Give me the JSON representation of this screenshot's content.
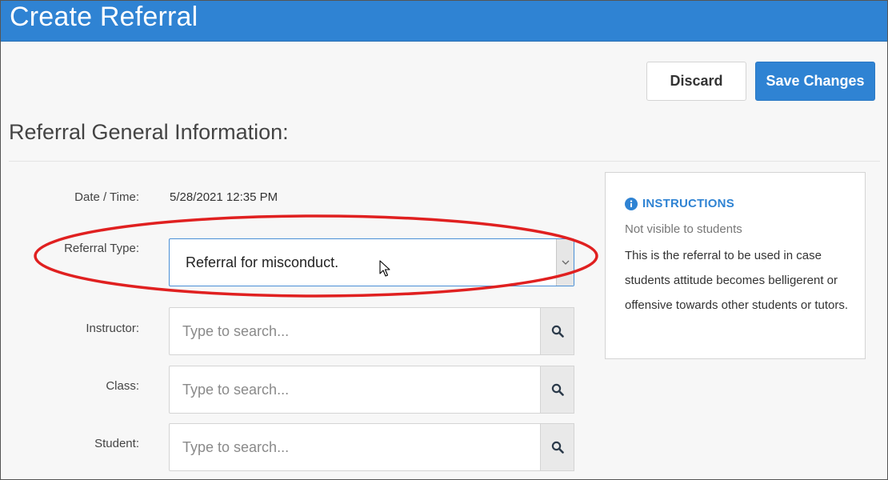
{
  "header": {
    "title": "Create Referral"
  },
  "actions": {
    "discard_label": "Discard",
    "save_label": "Save Changes"
  },
  "section": {
    "title": "Referral General Information:"
  },
  "form": {
    "date_label": "Date / Time:",
    "date_value": "5/28/2021 12:35 PM",
    "type_label": "Referral Type:",
    "type_value": "Referral for misconduct.",
    "instructor_label": "Instructor:",
    "instructor_placeholder": "Type to search...",
    "class_label": "Class:",
    "class_placeholder": "Type to search...",
    "student_label": "Student:",
    "student_placeholder": "Type to search..."
  },
  "instructions": {
    "heading": "INSTRUCTIONS",
    "note": "Not visible to students",
    "body": "This is the referral to be used in case students attitude becomes belligerent or offensive towards other students or tutors."
  },
  "icons": {
    "info": "info-icon",
    "search": "search-icon",
    "dropdown": "chevron-down-icon",
    "cursor": "mouse-cursor-icon"
  },
  "colors": {
    "header_bg": "#2f83d3",
    "primary_button": "#2f83d3",
    "annotation": "#e02020"
  }
}
